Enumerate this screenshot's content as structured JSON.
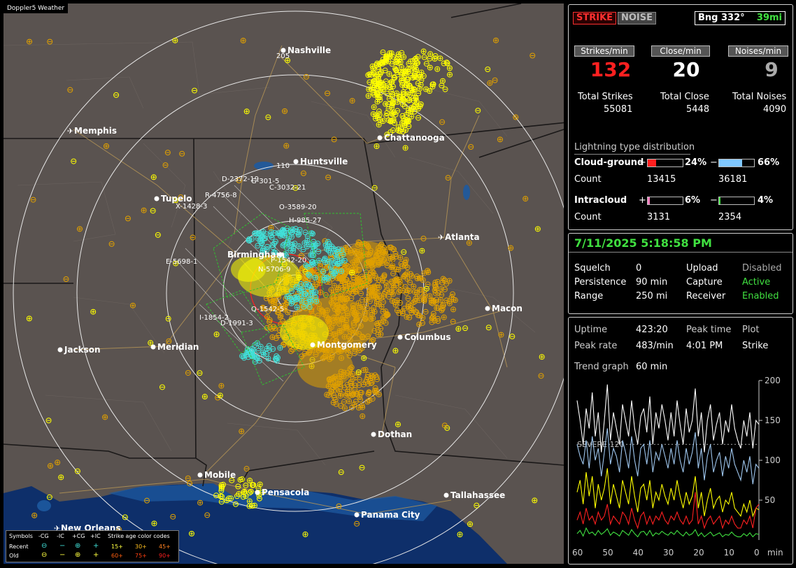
{
  "app": {
    "title": "Doppler5 Weather"
  },
  "map": {
    "cities": [
      {
        "name": "Nashville"
      },
      {
        "name": "Memphis"
      },
      {
        "name": "Chattanooga"
      },
      {
        "name": "Huntsville"
      },
      {
        "name": "Tupelo"
      },
      {
        "name": "Atlanta"
      },
      {
        "name": "Birmingham"
      },
      {
        "name": "Macon"
      },
      {
        "name": "Jackson"
      },
      {
        "name": "Meridian"
      },
      {
        "name": "Montgomery"
      },
      {
        "name": "Columbus"
      },
      {
        "name": "Dothan"
      },
      {
        "name": "Mobile"
      },
      {
        "name": "Pensacola"
      },
      {
        "name": "Tallahassee"
      },
      {
        "name": "Panama City"
      },
      {
        "name": "New Orleans"
      }
    ],
    "highways": [
      "205",
      "110"
    ],
    "cells": [
      "D-2372-19",
      "G-301-5",
      "C-3032-21",
      "R-4756-8",
      "X-1428-3",
      "O-3589-20",
      "H-985-27",
      "E-5698-1",
      "P-1542-20",
      "N-5706-9",
      "Q-1542-5",
      "I-1854-2",
      "D-1991-3"
    ],
    "strike_colors": {
      "recent_ic": "#40e0d8",
      "recent_cg": "#ffff00",
      "old_cg": "#e0a000",
      "close_ring": "#ff2020"
    }
  },
  "legend": {
    "symbols_label": "Symbols",
    "neg_cg": "-CG",
    "neg_ic": "-IC",
    "pos_cg": "+CG",
    "pos_ic": "+IC",
    "age_label": "Strike age color codes",
    "recent_label": "Recent",
    "old_label": "Old",
    "ages": [
      "15+",
      "30+",
      "45+",
      "60+",
      "75+",
      "90+"
    ],
    "age_colors": [
      "#ffff40",
      "#ffc020",
      "#ff8020",
      "#ff6010",
      "#ff4010",
      "#ff2020"
    ]
  },
  "status": {
    "strike_btn": "STRIKE",
    "noise_btn": "NOISE",
    "bearing": "Bng 332°",
    "distance": "39mi",
    "strikes_min_label": "Strikes/min",
    "close_min_label": "Close/min",
    "noises_min_label": "Noises/min",
    "strikes_min": "132",
    "close_min": "20",
    "noises_min": "9",
    "total_strikes_label": "Total Strikes",
    "total_close_label": "Total Close",
    "total_noises_label": "Total Noises",
    "total_strikes": "55081",
    "total_close": "5448",
    "total_noises": "4090"
  },
  "distribution": {
    "title": "Lightning type distribution",
    "cg_label": "Cloud-ground",
    "ic_label": "Intracloud",
    "count_label": "Count",
    "plus": "+",
    "minus": "−",
    "cg_pos_pct": "24%",
    "cg_neg_pct": "66%",
    "cg_pos_count": "13415",
    "cg_neg_count": "36181",
    "ic_pos_pct": "6%",
    "ic_neg_pct": "4%",
    "ic_pos_count": "3131",
    "ic_neg_count": "2354",
    "cg_pos_frac": 0.24,
    "cg_neg_frac": 0.66,
    "ic_pos_frac": 0.06,
    "ic_neg_frac": 0.04,
    "colors": {
      "cg_pos": "#ff2020",
      "cg_neg": "#80c8ff",
      "ic_pos": "#ff80c0",
      "ic_neg": "#40e040"
    }
  },
  "settings": {
    "datetime": "7/11/2025 5:18:58 PM",
    "squelch_label": "Squelch",
    "squelch": "0",
    "persistence_label": "Persistence",
    "persistence": "90 min",
    "range_label": "Range",
    "range": "250 mi",
    "upload_label": "Upload",
    "upload": "Disabled",
    "capture_label": "Capture",
    "capture": "Active",
    "receiver_label": "Receiver",
    "receiver": "Enabled"
  },
  "trend": {
    "uptime_label": "Uptime",
    "uptime": "423:20",
    "peak_time_label": "Peak time",
    "peak_time": "4:01 PM",
    "plot_label": "Plot",
    "plot": "Strike",
    "peak_rate_label": "Peak rate",
    "peak_rate": "483/min",
    "trend_graph_label": "Trend graph",
    "trend_graph": "60 min",
    "severe_label": "SEVERE 120",
    "y_ticks": [
      "200",
      "150",
      "100",
      "50"
    ],
    "x_ticks": [
      "60",
      "50",
      "40",
      "30",
      "20",
      "10",
      "0"
    ],
    "x_unit": "min"
  },
  "chart_data": {
    "type": "line",
    "xlabel": "min",
    "ylabel": "",
    "ylim": [
      0,
      200
    ],
    "xlim": [
      60,
      0
    ],
    "threshold": {
      "label": "SEVERE 120",
      "value": 120
    },
    "series": [
      {
        "color": "#ffffff",
        "values": [
          175,
          150,
          120,
          165,
          140,
          185,
          130,
          160,
          110,
          150,
          195,
          125,
          160,
          140,
          120,
          170,
          150,
          130,
          175,
          140,
          120,
          155,
          165,
          135,
          180,
          120,
          160,
          140,
          170,
          150,
          125,
          160,
          130,
          175,
          145,
          120,
          165,
          135,
          150,
          190,
          130,
          160,
          110,
          150,
          170,
          125,
          145,
          160,
          120,
          150,
          135,
          170,
          140,
          125,
          115,
          150,
          130,
          160,
          115,
          150,
          145
        ]
      },
      {
        "color": "#a0c8f0",
        "values": [
          120,
          105,
          95,
          125,
          90,
          130,
          100,
          115,
          80,
          110,
          140,
          95,
          115,
          105,
          85,
          125,
          110,
          90,
          130,
          100,
          80,
          115,
          120,
          95,
          125,
          85,
          110,
          100,
          120,
          105,
          90,
          115,
          95,
          125,
          100,
          85,
          115,
          95,
          110,
          135,
          90,
          115,
          75,
          105,
          120,
          85,
          100,
          110,
          80,
          105,
          90,
          115,
          95,
          85,
          75,
          100,
          85,
          105,
          70,
          95,
          90
        ]
      },
      {
        "color": "#ffff00",
        "values": [
          60,
          75,
          45,
          85,
          55,
          80,
          40,
          70,
          50,
          65,
          90,
          45,
          70,
          55,
          40,
          75,
          60,
          45,
          80,
          55,
          35,
          65,
          70,
          50,
          75,
          40,
          60,
          50,
          70,
          55,
          45,
          65,
          50,
          75,
          55,
          40,
          60,
          45,
          55,
          80,
          40,
          60,
          30,
          50,
          65,
          40,
          50,
          55,
          35,
          50,
          45,
          60,
          40,
          35,
          30,
          45,
          35,
          50,
          30,
          40,
          38
        ]
      },
      {
        "color": "#ff2020",
        "values": [
          25,
          35,
          20,
          40,
          25,
          30,
          20,
          35,
          25,
          30,
          45,
          20,
          30,
          25,
          20,
          35,
          30,
          20,
          40,
          25,
          15,
          30,
          35,
          20,
          30,
          20,
          30,
          25,
          35,
          25,
          20,
          30,
          25,
          35,
          25,
          20,
          30,
          20,
          25,
          60,
          20,
          30,
          15,
          25,
          30,
          20,
          25,
          30,
          15,
          25,
          20,
          30,
          20,
          15,
          15,
          25,
          20,
          30,
          15,
          40,
          45
        ]
      },
      {
        "color": "#40e040",
        "values": [
          8,
          12,
          5,
          15,
          8,
          10,
          6,
          12,
          7,
          10,
          14,
          6,
          10,
          8,
          5,
          12,
          9,
          6,
          13,
          8,
          4,
          10,
          11,
          6,
          12,
          5,
          9,
          7,
          11,
          8,
          6,
          10,
          7,
          12,
          8,
          5,
          10,
          6,
          8,
          13,
          5,
          9,
          4,
          7,
          10,
          5,
          7,
          9,
          4,
          7,
          6,
          10,
          6,
          4,
          4,
          8,
          5,
          9,
          4,
          8,
          7
        ]
      }
    ]
  }
}
